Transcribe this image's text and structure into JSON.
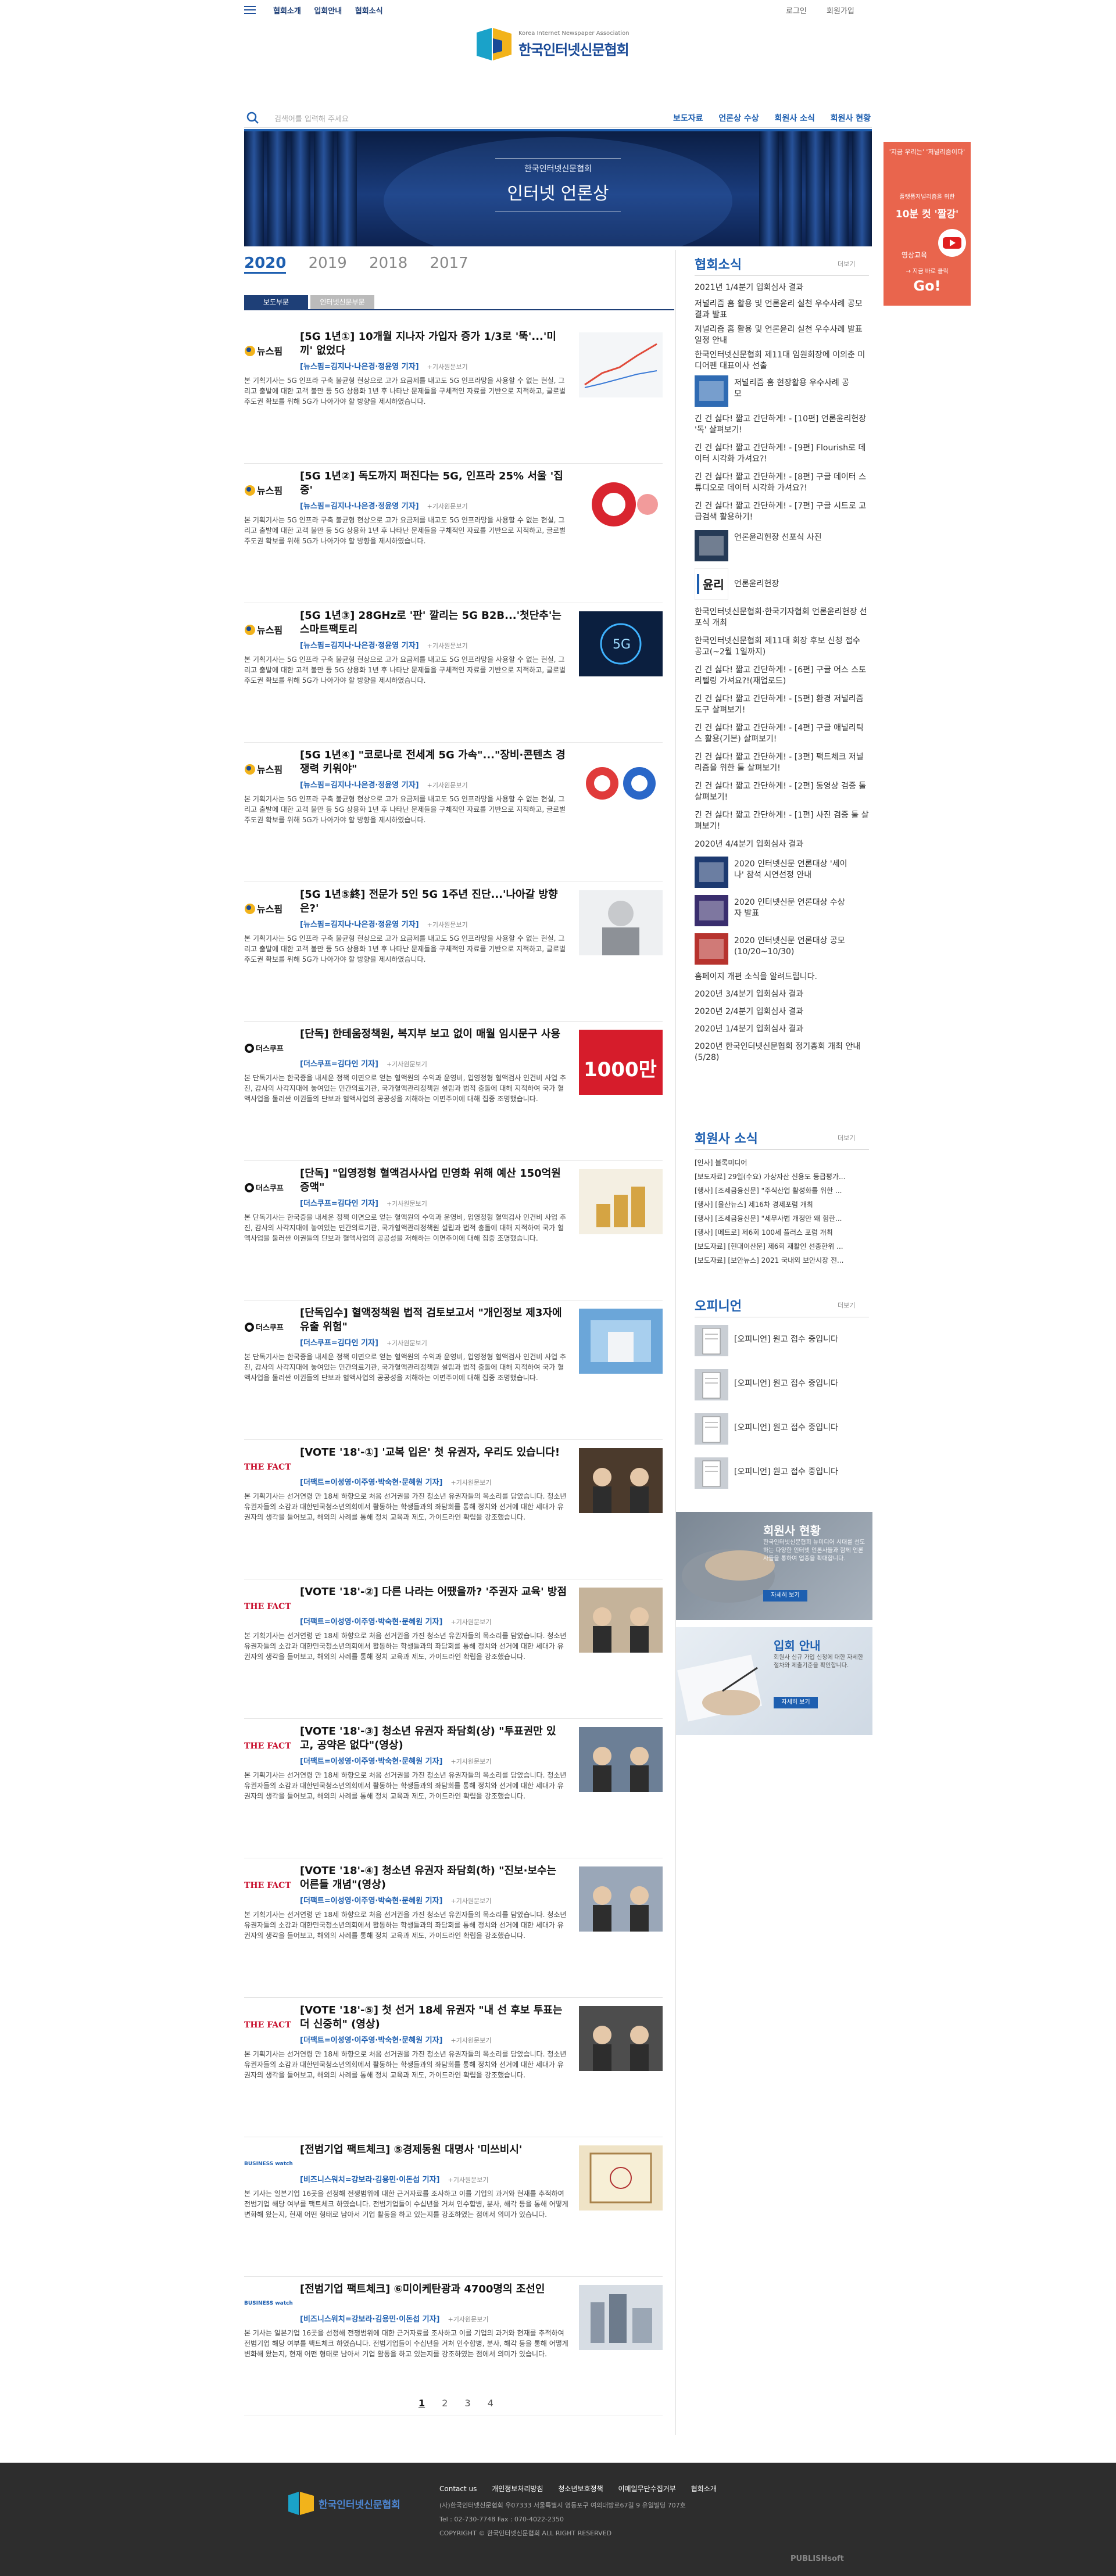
{
  "top": {
    "links": [
      "협회소개",
      "입회안내",
      "협회소식"
    ],
    "login": "로그인",
    "join": "회원가입"
  },
  "logo": {
    "en": "Korea Internet Newspaper Association",
    "ko": "한국인터넷신문협회"
  },
  "search": {
    "placeholder": "검색어를 입력해 주세요"
  },
  "nav": [
    "보도자료",
    "언론상 수상",
    "회원사 소식",
    "회원사 현황"
  ],
  "banner": {
    "sub": "한국인터넷신문협회",
    "title": "인터넷 언론상"
  },
  "years": [
    "2020",
    "2019",
    "2018",
    "2017"
  ],
  "tabs": [
    "보도부문",
    "인터넷신문부문"
  ],
  "original_link": "+기사원문보기",
  "articles": [
    {
      "source": "뉴스핌",
      "title": "[5G 1년①] 10개월 지나자 가입자 증가 1/3로 '뚝'...'미끼' 없었다",
      "meta": "[뉴스핌=김지나·나은경·정윤영 기자]",
      "summary": "본 기획기사는 5G 인프라 구축 불균형 현상으로 고가 요금제를 내고도 5G 인프라망을 사용할 수 없는 현실, 그리고 출발에 대한 고객 불만 등 5G 상용화 1년 후 나타난 문제들을 구체적인 자료를 기반으로 지적하고, 글로벌 주도권 확보를 위해 5G가 나아가야 할 방향을 제시하였습니다."
    },
    {
      "source": "뉴스핌",
      "title": "[5G 1년②] 독도까지 퍼진다는 5G, 인프라 25% 서울 '집중'",
      "meta": "[뉴스핌=김지나·나은경·정윤영 기자]",
      "summary": "본 기획기사는 5G 인프라 구축 불균형 현상으로 고가 요금제를 내고도 5G 인프라망을 사용할 수 없는 현실, 그리고 출발에 대한 고객 불만 등 5G 상용화 1년 후 나타난 문제들을 구체적인 자료를 기반으로 지적하고, 글로벌 주도권 확보를 위해 5G가 나아가야 할 방향을 제시하였습니다."
    },
    {
      "source": "뉴스핌",
      "title": "[5G 1년③] 28GHz로 '판' 깔리는 5G B2B...'첫단추'는 스마트팩토리",
      "meta": "[뉴스핌=김지나·나은경·정윤영 기자]",
      "summary": "본 기획기사는 5G 인프라 구축 불균형 현상으로 고가 요금제를 내고도 5G 인프라망을 사용할 수 없는 현실, 그리고 출발에 대한 고객 불만 등 5G 상용화 1년 후 나타난 문제들을 구체적인 자료를 기반으로 지적하고, 글로벌 주도권 확보를 위해 5G가 나아가야 할 방향을 제시하였습니다."
    },
    {
      "source": "뉴스핌",
      "title": "[5G 1년④] \"코로나로 전세계 5G 가속\"...\"장비·콘텐츠 경쟁력 키워야\"",
      "meta": "[뉴스핌=김지나·나은경·정윤영 기자]",
      "summary": "본 기획기사는 5G 인프라 구축 불균형 현상으로 고가 요금제를 내고도 5G 인프라망을 사용할 수 없는 현실, 그리고 출발에 대한 고객 불만 등 5G 상용화 1년 후 나타난 문제들을 구체적인 자료를 기반으로 지적하고, 글로벌 주도권 확보를 위해 5G가 나아가야 할 방향을 제시하였습니다."
    },
    {
      "source": "뉴스핌",
      "title": "[5G 1년⑤終] 전문가 5인 5G 1주년 진단...'나아갈 방향은?'",
      "meta": "[뉴스핌=김지나·나은경·정윤영 기자]",
      "summary": "본 기획기사는 5G 인프라 구축 불균형 현상으로 고가 요금제를 내고도 5G 인프라망을 사용할 수 없는 현실, 그리고 출발에 대한 고객 불만 등 5G 상용화 1년 후 나타난 문제들을 구체적인 자료를 기반으로 지적하고, 글로벌 주도권 확보를 위해 5G가 나아가야 할 방향을 제시하였습니다."
    },
    {
      "source": "더스쿠프",
      "title": "[단독] 한테움정책원, 복지부 보고 없이 매월 임시문구 사용",
      "meta": "[더스쿠프=김다인 기자]",
      "summary": "본 단독기사는 한국증을 내세운 정책 이면으로 얻는 혈액원의 수익과 운영비, 입영정형 혈액검사 인건비 사업 추진, 감사의 사각지대에 놓여있는 민간의료기관, 국가혈액관리정책원 설립과 법적 충돌에 대해 지적하여 국가 혈액사업을 둘러싼 이권들의 단보과 혈액사업의 공공성을 저해하는 이면주이에 대해 집중 조명했습니다."
    },
    {
      "source": "더스쿠프",
      "title": "[단독] \"입영정형 혈액검사사업 민영화 위해 예산 150억원 증액\"",
      "meta": "[더스쿠프=김다인 기자]",
      "summary": "본 단독기사는 한국증을 내세운 정책 이면으로 얻는 혈액원의 수익과 운영비, 입영정형 혈액검사 인건비 사업 추진, 감사의 사각지대에 놓여있는 민간의료기관, 국가혈액관리정책원 설립과 법적 충돌에 대해 지적하여 국가 혈액사업을 둘러싼 이권들의 단보과 혈액사업의 공공성을 저해하는 이면주이에 대해 집중 조명했습니다."
    },
    {
      "source": "더스쿠프",
      "title": "[단독입수] 혈액정책원 법적 검토보고서 \"개인정보 제3자에 유출 위험\"",
      "meta": "[더스쿠프=김다인 기자]",
      "summary": "본 단독기사는 한국증을 내세운 정책 이면으로 얻는 혈액원의 수익과 운영비, 입영정형 혈액검사 인건비 사업 추진, 감사의 사각지대에 놓여있는 민간의료기관, 국가혈액관리정책원 설립과 법적 충돌에 대해 지적하여 국가 혈액사업을 둘러싼 이권들의 단보과 혈액사업의 공공성을 저해하는 이면주이에 대해 집중 조명했습니다."
    },
    {
      "source": "THE FACT",
      "title": "[VOTE '18'-①] '교복 입은' 첫 유권자, 우리도 있습니다!",
      "meta": "[더팩트=이성영·이주영·박숙현·문혜원 기자]",
      "summary": "본 기획기사는 선거연령 만 18세 하향으로 처음 선거권을 가진 청소년 유권자들의 목소리를 담았습니다. 청소년 유권자들의 소감과 대한민국청소년의회에서 활동하는 학생들과의 좌담회를 통해 정치와 선거에 대한 세대가 유권자의 생각을 들어보고, 해외의 사례를 통해 정치 교육과 제도, 가이드라인 확립을 강조했습니다."
    },
    {
      "source": "THE FACT",
      "title": "[VOTE '18'-②] 다른 나라는 어땠을까? '주권자 교육' 방점",
      "meta": "[더팩트=이성영·이주영·박숙현·문혜원 기자]",
      "summary": "본 기획기사는 선거연령 만 18세 하향으로 처음 선거권을 가진 청소년 유권자들의 목소리를 담았습니다. 청소년 유권자들의 소감과 대한민국청소년의회에서 활동하는 학생들과의 좌담회를 통해 정치와 선거에 대한 세대가 유권자의 생각을 들어보고, 해외의 사례를 통해 정치 교육과 제도, 가이드라인 확립을 강조했습니다."
    },
    {
      "source": "THE FACT",
      "title": "[VOTE '18'-③] 청소년 유권자 좌담회(상) \"투표권만 있고, 공약은 없다\"(영상)",
      "meta": "[더팩트=이성영·이주영·박숙현·문혜원 기자]",
      "summary": "본 기획기사는 선거연령 만 18세 하향으로 처음 선거권을 가진 청소년 유권자들의 목소리를 담았습니다. 청소년 유권자들의 소감과 대한민국청소년의회에서 활동하는 학생들과의 좌담회를 통해 정치와 선거에 대한 세대가 유권자의 생각을 들어보고, 해외의 사례를 통해 정치 교육과 제도, 가이드라인 확립을 강조했습니다."
    },
    {
      "source": "THE FACT",
      "title": "[VOTE '18'-④] 청소년 유권자 좌담회(하) \"진보·보수는 어른들 개념\"(영상)",
      "meta": "[더팩트=이성영·이주영·박숙현·문혜원 기자]",
      "summary": "본 기획기사는 선거연령 만 18세 하향으로 처음 선거권을 가진 청소년 유권자들의 목소리를 담았습니다. 청소년 유권자들의 소감과 대한민국청소년의회에서 활동하는 학생들과의 좌담회를 통해 정치와 선거에 대한 세대가 유권자의 생각을 들어보고, 해외의 사례를 통해 정치 교육과 제도, 가이드라인 확립을 강조했습니다."
    },
    {
      "source": "THE FACT",
      "title": "[VOTE '18'-⑤] 첫 선거 18세 유권자 \"내 선 후보 투표는 더 신중히\" (영상)",
      "meta": "[더팩트=이성영·이주영·박숙현·문혜원 기자]",
      "summary": "본 기획기사는 선거연령 만 18세 하향으로 처음 선거권을 가진 청소년 유권자들의 목소리를 담았습니다. 청소년 유권자들의 소감과 대한민국청소년의회에서 활동하는 학생들과의 좌담회를 통해 정치와 선거에 대한 세대가 유권자의 생각을 들어보고, 해외의 사례를 통해 정치 교육과 제도, 가이드라인 확립을 강조했습니다."
    },
    {
      "source": "BUSINESS watch",
      "title": "[전범기업 팩트체크] ⑤경제동원 대명사 '미쓰비시'",
      "meta": "[비즈니스워치=강보라·김용민·이돈섭 기자]",
      "summary": "본 기사는 일본기업 16곳을 선정해 전쟁범위에 대한 근거자료를 조사하고 이를 기업의 과거와 현재를 추적하여 전범기업 해당 여부를 팩트체크 하였습니다. 전범기업들이 수십년을 거쳐 인수합병, 분사, 해각 등을 통해 어떻게 변화해 왔는지, 현재 어떤 형태로 남아서 기업 활동을 하고 있는지를 강조하였는 점에서 의미가 있습니다."
    },
    {
      "source": "BUSINESS watch",
      "title": "[전범기업 팩트체크] ⑥미이케탄광과 4700명의 조선인",
      "meta": "[비즈니스워치=강보라·김용민·이돈섭 기자]",
      "summary": "본 기사는 일본기업 16곳을 선정해 전쟁범위에 대한 근거자료를 조사하고 이를 기업의 과거와 현재를 추적하여 전범기업 해당 여부를 팩트체크 하였습니다. 전범기업들이 수십년을 거쳐 인수합병, 분사, 해각 등을 통해 어떻게 변화해 왔는지, 현재 어떤 형태로 남아서 기업 활동을 하고 있는지를 강조하였는 점에서 의미가 있습니다."
    }
  ],
  "pages": [
    "1",
    "2",
    "3",
    "4"
  ],
  "sidebar": {
    "news_title": "협회소식",
    "more": "더보기",
    "news": [
      "2021년 1/4분기 입회심사 결과",
      "저널리즘 홈 활용 및 언론윤리 실천 우수사례 공모 결과 발표",
      "저널리즘 홈 활용 및 언론윤리 실천 우수사례 발표 일정 안내",
      "한국인터넷신문협회 제11대 임원회장에 이의춘 미디어펜 대표이사 선출"
    ],
    "news_thumb1": "저널리즘 홈 현장활용 우수사례 공모",
    "news2": [
      "긴 건 싫다! 짧고 간단하게! - [10편] 언론윤리헌장 '독' 살펴보기!",
      "긴 건 싫다! 짧고 간단하게! - [9편] Flourish로 데이터 시각화 가셔요?!",
      "긴 건 싫다! 짧고 간단하게! - [8편] 구글 데이터 스튜디오로 데이터 시각화 가셔요?!",
      "긴 건 싫다! 짧고 간단하게! - [7편] 구글 시트로 고급검색 활용하기!"
    ],
    "news_thumb2": "언론윤리헌장 선포식 사진",
    "ethics_label": "윤리",
    "ethics_caption": "언론윤리헌장",
    "news3": [
      "한국인터넷신문협회·한국기자협회 언론윤리헌장 선포식 개최",
      "한국인터넷신문협회 제11대 회장 후보 신청 접수 공고(~2월 1일까지)",
      "긴 건 싫다! 짧고 간단하게! - [6편] 구글 어스 스토리텔링 가셔요?!(재업로드)",
      "긴 건 싫다! 짧고 간단하게! - [5편] 환경 저널리즘 도구 살펴보기!",
      "긴 건 싫다! 짧고 간단하게! - [4편] 구글 애널리틱스 활용(기본) 살펴보기!",
      "긴 건 싫다! 짧고 간단하게! - [3편] 팩트체크 저널리즘을 위한 툴 살펴보기!",
      "긴 건 싫다! 짧고 간단하게! - [2편] 동영상 검증 툴 살펴보기!",
      "긴 건 싫다! 짧고 간단하게! - [1편] 사진 검증 툴 살펴보기!",
      "2020년 4/4분기 입회심사 결과"
    ],
    "thumb_items": [
      "2020 인터넷신문 언론대상 '세이나' 참석 시연선정 안내",
      "2020 인터넷신문 언론대상 수상자 발표",
      "2020 인터넷신문 언론대상 공모(10/20~10/30)"
    ],
    "news4": [
      "홈페이지 개편 소식을 알려드립니다.",
      "2020년 3/4분기 입회심사 결과",
      "2020년 2/4분기 입회심사 결과",
      "2020년 1/4분기 입회심사 결과",
      "2020년 한국인터넷신문협회 정기총회 개최 안내(5/28)"
    ],
    "member_title": "회원사 소식",
    "member": [
      "[인사] 블록미디어",
      "[보도자료] 29일(수요) 가상자산 신용도 등급평가...",
      "[행사] [조세금융신문] \"주식산업 활성화를 위한 ...",
      "[행사] [울산뉴스] 제16차 경제포럼 개최",
      "[행사] [조세금융신문] \"세무사법 개정안 왜 힘한...",
      "[행사] [메트로] 제6회 100세 플러스 포럼 개최",
      "[보도자료] [현대이산문] 제6회 재활인 선종한위 ...",
      "[보도자료] [보안뉴스] 2021 국내외 보안시장 전..."
    ],
    "opinion_title": "오피니언",
    "opinion": [
      "[오피니언] 원고 접수 중입니다",
      "[오피니언] 원고 접수 중입니다",
      "[오피니언] 원고 접수 중입니다",
      "[오피니언] 원고 접수 중입니다"
    ],
    "card1": {
      "title": "회원사 현황",
      "desc": "한국인터넷신문협회 뉴미디어 시대를 선도하는 다양한 인터넷 언론사들과 함께 언론사들을 통하여 업종을 확대합니다.",
      "btn": "자세히 보기"
    },
    "card2": {
      "title": "입회 안내",
      "desc": "회원사 신규 가입 신청에 대한 자세한 절차와 제출기준을 확인합니다.",
      "btn": "자세히 보기"
    }
  },
  "float_ad": {
    "line1": "'지금 우리는' '저널리즘이다'",
    "line2": "플랫폼저널리즘을 위한",
    "line3": "10분 컷 '짤강'",
    "line4": "영상교육",
    "line5": "→ 지금 바로 클릭",
    "line6": "Go!"
  },
  "footer": {
    "logo": "한국인터넷신문협회",
    "links": [
      "Contact us",
      "개인정보처리방침",
      "청소년보호정책",
      "이메일무단수집거부",
      "협회소개"
    ],
    "address": "(사)한국인터넷신문협회 우07333 서울특별시 영등포구 여의대방로67길 9 유일빌딩 707호",
    "tel": "Tel : 02-730-7748 Fax : 070-4022-2350",
    "copyright": "COPYRIGHT © 한국인터넷신문협회 ALL RIGHT RESERVED",
    "publisher": "PUBLISHsoft"
  },
  "colors": {
    "brand": "#1e5fb0",
    "navy": "#1e3f77",
    "footer": "#2d2d2d",
    "ad": "#e9654d"
  }
}
